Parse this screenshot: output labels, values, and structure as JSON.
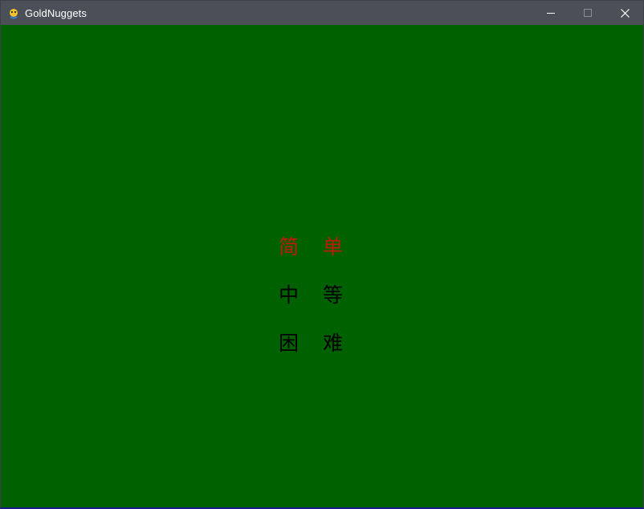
{
  "window": {
    "title": "GoldNuggets",
    "app_icon": "pygame-snake-icon",
    "controls": {
      "minimize_icon": "minimize-icon",
      "maximize_icon": "maximize-icon",
      "close_icon": "close-icon"
    }
  },
  "colors": {
    "background": "#006100",
    "selected_text": "#c01a0a",
    "normal_text": "#000000",
    "titlebar": "#4b5058"
  },
  "difficulty_menu": {
    "items": [
      {
        "label": "简单",
        "selected": true
      },
      {
        "label": "中等",
        "selected": false
      },
      {
        "label": "困难",
        "selected": false
      }
    ]
  }
}
